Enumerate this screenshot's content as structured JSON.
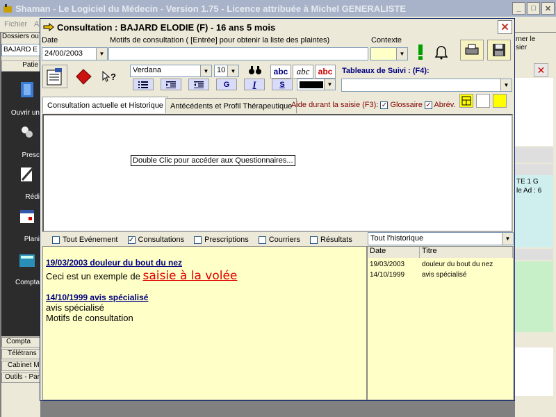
{
  "app": {
    "title": "Shaman - Le Logiciel du Médecin - Version 1.75 - Licence attribuée à Michel GENERALISTE",
    "menu": [
      "Fichier",
      "A"
    ],
    "win_min": "_",
    "win_max": "□",
    "win_close": "✕"
  },
  "left": {
    "dossiers_label": "Dossiers ou",
    "patient_value": "BAJARD E",
    "tab_header": "Patie",
    "items": [
      {
        "label": "Ouvrir un",
        "icon": "folder-icon"
      },
      {
        "label": "Presc",
        "icon": "pill-icon"
      },
      {
        "label": "Rédi",
        "icon": "pen-icon"
      },
      {
        "label": "Plani",
        "icon": "calendar-icon"
      },
      {
        "label": "Compta",
        "icon": "calculator-icon"
      }
    ],
    "bottom_tabs": [
      "Compta",
      "Télétrans",
      "Cabinet M",
      "Outils - Par"
    ]
  },
  "right": {
    "text_line1": "rner le",
    "text_line2": "sier",
    "cyan_line1": "TE 1 G",
    "cyan_line2": "le Ad : 6"
  },
  "dialog": {
    "title": "Consultation : BAJARD ELODIE (F) -  16 ans 5 mois",
    "close": "✕",
    "date_label": "Date",
    "date_value": "24/00/2003",
    "motifs_label": "Motifs de consultation ( [Entrée]  pour obtenir la liste des plaintes)",
    "motifs_value": "",
    "contexte_label": "Contexte",
    "contexte_value": "",
    "toolbar": {
      "font_name": "Verdana",
      "font_size": "10",
      "bold_label": "G",
      "italic_label": "I",
      "underline_label": "S",
      "abc1": "abc",
      "abc2": "abc",
      "abc3": "abc",
      "help_label": "?"
    },
    "tableaux_label": "Tableaux de Suivi : (F4):",
    "tableaux_value": "",
    "tabs": [
      {
        "label": "Consultation actuelle et Historique"
      },
      {
        "label": "Antécédents et Profil Thérapeutique"
      }
    ],
    "aide_label": "Aide durant la saisie (F3):",
    "glossaire_label": "Glossaire",
    "abrev_label": "Abrév.",
    "tooltip": "Double Clic pour accéder aux Questionnaires...",
    "filters": [
      {
        "label": "Tout Evénement",
        "checked": false
      },
      {
        "label": "Consultations",
        "checked": true
      },
      {
        "label": "Prescriptions",
        "checked": false
      },
      {
        "label": "Courriers",
        "checked": false
      },
      {
        "label": "Résultats",
        "checked": false
      }
    ],
    "history_filter": "Tout l'historique",
    "notes": {
      "entry1_head": "19/03/2003 douleur du bout du nez",
      "entry1_prefix": "Ceci est un exemple de ",
      "entry1_big": "saisie à la volée",
      "entry2_head": "14/10/1999 avis spécialisé",
      "entry2_line1": "avis spécialisé",
      "entry2_line2": "Motifs de consultation"
    },
    "history": {
      "col_date": "Date",
      "col_title": "Titre",
      "rows": [
        {
          "date": "19/03/2003",
          "title": "douleur du bout du nez"
        },
        {
          "date": "14/10/1999",
          "title": "avis spécialisé"
        }
      ]
    }
  }
}
